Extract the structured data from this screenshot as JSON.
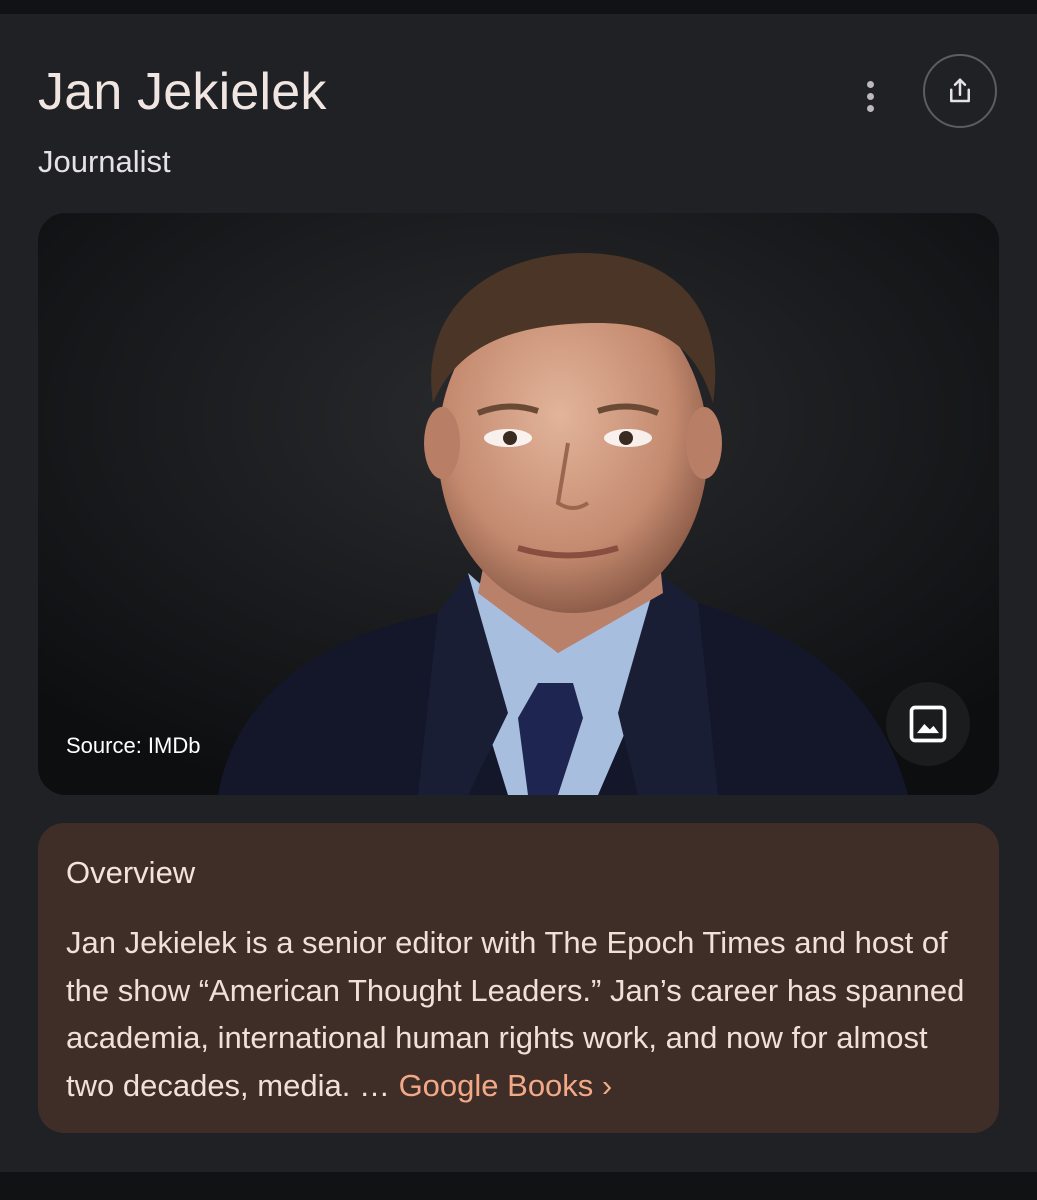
{
  "header": {
    "title": "Jan Jekielek",
    "subtitle": "Journalist",
    "more_icon": "more-vertical-icon",
    "share_icon": "share-icon"
  },
  "image": {
    "source": "Source: IMDb",
    "image_icon": "image-icon"
  },
  "overview": {
    "heading": "Overview",
    "body": "Jan Jekielek is a senior editor with The Epoch Times and host of the show “American Thought Leaders.” Jan’s career has spanned academia, international human rights work, and now for almost two decades, media. … ",
    "link_label": "Google Books",
    "link_chevron": "›"
  },
  "colors": {
    "background": "#1f2125",
    "overview_bg": "#3e2e27",
    "link": "#f3a987"
  }
}
